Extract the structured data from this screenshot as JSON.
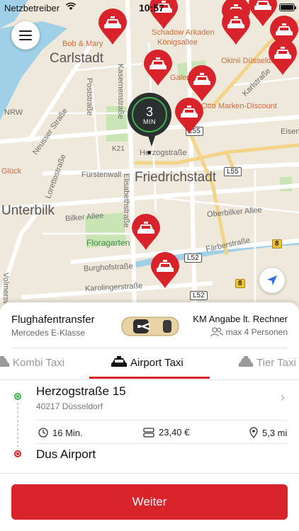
{
  "status_bar": {
    "carrier": "Netzbetreiber",
    "time": "10:57",
    "battery_fill": 0.9
  },
  "map": {
    "district_labels": [
      "Carlstadt",
      "Friedrichstadt",
      "Unterbilk"
    ],
    "street_labels": [
      "Kasernenstraße",
      "Herzogstraße",
      "Fürstenwall",
      "Elisabethstraße",
      "Bilker Allee",
      "Oberbilker Allee",
      "Neusser Straße",
      "Lorettostraße",
      "Poststraße",
      "Burghofstraße",
      "Karolingerstraße",
      "Färberstraße",
      "Karlstraße",
      "Volmerswerther",
      "Eisens"
    ],
    "poi_labels": [
      "Bob & Mary",
      "Schadow Arkaden",
      "Königsallee",
      "Okinii Düsseldorf",
      "Otto Marken-Discount",
      "Galer",
      "Floragarten",
      "NRW",
      "K21",
      "Glück"
    ],
    "road_tags": [
      "L55",
      "L55",
      "L52",
      "L52",
      "8",
      "8"
    ],
    "eta": {
      "value": "3",
      "unit": "MIN"
    },
    "colors": {
      "pin": "#d8232a",
      "water": "#9fd0e8",
      "park": "#c9e5b5"
    }
  },
  "ride": {
    "title": "Flughafentransfer",
    "vehicle": "Mercedes E-Klasse",
    "price_note": "KM Angabe lt. Rechner",
    "capacity": "max 4 Personen"
  },
  "tabs": [
    {
      "label": "Kombi Taxi",
      "active": false
    },
    {
      "label": "Airport Taxi",
      "active": true
    },
    {
      "label": "Tier Taxi",
      "active": false
    }
  ],
  "route": {
    "pickup_street": "Herzogstraße 15",
    "pickup_city": "40217 Düsseldorf",
    "duration": "16 Min.",
    "price": "23,40 €",
    "distance": "5,3 mi",
    "destination": "Dus Airport"
  },
  "cta_label": "Weiter",
  "accent_color": "#d8232a"
}
